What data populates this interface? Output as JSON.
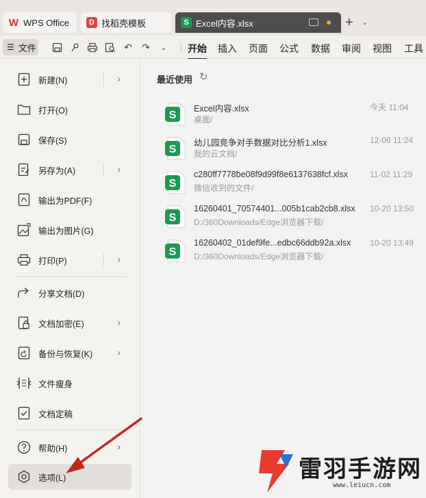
{
  "tabs": {
    "wps_label": "WPS Office",
    "find_label": "找稻壳模板",
    "excel_label": "Excel内容.xlsx"
  },
  "toolbar": {
    "file_label": "文件",
    "menu_tabs": [
      "开始",
      "插入",
      "页面",
      "公式",
      "数据",
      "审阅",
      "视图",
      "工具"
    ]
  },
  "file_menu": {
    "items": [
      {
        "label": "新建(N)",
        "icon": "new-file-icon",
        "has_submenu": true
      },
      {
        "label": "打开(O)",
        "icon": "open-folder-icon",
        "has_submenu": false
      },
      {
        "label": "保存(S)",
        "icon": "save-icon",
        "has_submenu": false
      },
      {
        "label": "另存为(A)",
        "icon": "save-as-icon",
        "has_submenu": true
      },
      {
        "label": "输出为PDF(F)",
        "icon": "export-pdf-icon",
        "has_submenu": false
      },
      {
        "label": "输出为图片(G)",
        "icon": "export-image-icon",
        "has_submenu": false
      },
      {
        "label": "打印(P)",
        "icon": "print-icon",
        "has_submenu": true
      },
      {
        "label": "分享文档(D)",
        "icon": "share-icon",
        "has_submenu": false
      },
      {
        "label": "文档加密(E)",
        "icon": "encrypt-icon",
        "has_submenu": true
      },
      {
        "label": "备份与恢复(K)",
        "icon": "backup-icon",
        "has_submenu": true
      },
      {
        "label": "文件瘦身",
        "icon": "slim-file-icon",
        "has_submenu": false
      },
      {
        "label": "文档定稿",
        "icon": "finalize-icon",
        "has_submenu": false
      },
      {
        "label": "帮助(H)",
        "icon": "help-icon",
        "has_submenu": true
      },
      {
        "label": "选项(L)",
        "icon": "options-gear-icon",
        "has_submenu": false
      }
    ]
  },
  "recent": {
    "title": "最近使用",
    "files": [
      {
        "name": "Excel内容.xlsx",
        "path": "桌面/",
        "date": "今天  11:04"
      },
      {
        "name": "幼儿园竞争对手数据对比分析1.xlsx",
        "path": "我的云文档/",
        "date": "12-06 11:24"
      },
      {
        "name": "c280ff7778be08f9d99f8e6137638fcf.xlsx",
        "path": "微信收到的文件/",
        "date": "11-02 11:29"
      },
      {
        "name": "16260401_70574401...005b1cab2cb8.xlsx",
        "path": "D:/360Downloads/Edge浏览器下载/",
        "date": "10-20 13:50"
      },
      {
        "name": "16260402_01def9fe...edbc66ddb92a.xlsx",
        "path": "D:/360Downloads/Edge浏览器下载/",
        "date": "10-20 13:49"
      }
    ]
  },
  "watermark": {
    "text": "雷羽手游网",
    "url": "www.leiucn.com"
  },
  "colors": {
    "accent_red": "#d9302c",
    "sheet_green": "#1a9a52",
    "arrow_red": "#c9231f"
  }
}
